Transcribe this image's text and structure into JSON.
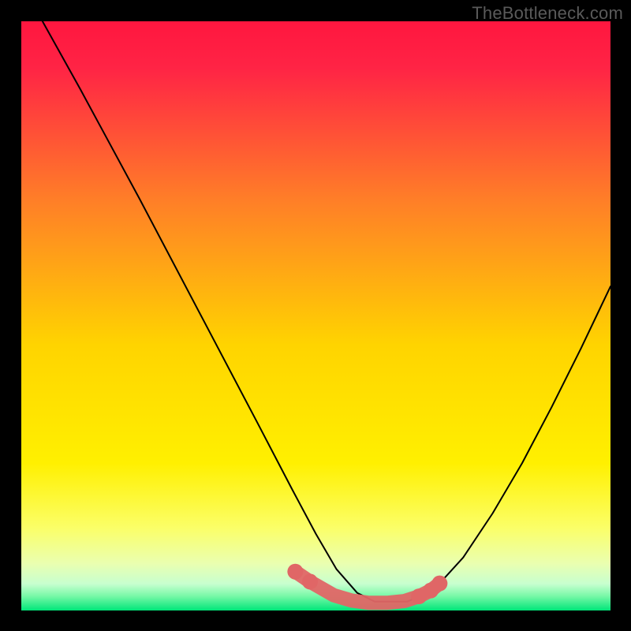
{
  "watermark": "TheBottleneck.com",
  "chart_data": {
    "type": "line",
    "title": "",
    "xlabel": "",
    "ylabel": "",
    "xlim": [
      0,
      100
    ],
    "ylim": [
      0,
      100
    ],
    "background_gradient": {
      "top": "#ff1a4a",
      "mid_upper": "#ff7a2a",
      "mid": "#ffe100",
      "mid_lower": "#f8ff7a",
      "bottom": "#00e86a"
    },
    "series": [
      {
        "name": "curve",
        "color": "#000000",
        "stroke_width": 2,
        "x": [
          3.6,
          10,
          20,
          30,
          40,
          46,
          50,
          53.5,
          57,
          60,
          65.5,
          70,
          75,
          80,
          85,
          90,
          95,
          100
        ],
        "y": [
          100,
          88.5,
          70,
          51,
          32,
          20.5,
          13,
          7,
          3,
          1.5,
          1.5,
          3.5,
          9,
          16.5,
          25,
          34.5,
          44.5,
          55
        ]
      },
      {
        "name": "highlight-dots",
        "color": "#e06666",
        "type": "scatter",
        "marker_size": 9,
        "x": [
          46.5,
          49,
          53,
          56,
          59,
          62,
          65,
          67.5,
          69.5,
          71
        ],
        "y": [
          6.6,
          4.9,
          2.6,
          1.7,
          1.3,
          1.3,
          1.6,
          2.4,
          3.4,
          4.6
        ]
      }
    ],
    "annotations": []
  }
}
